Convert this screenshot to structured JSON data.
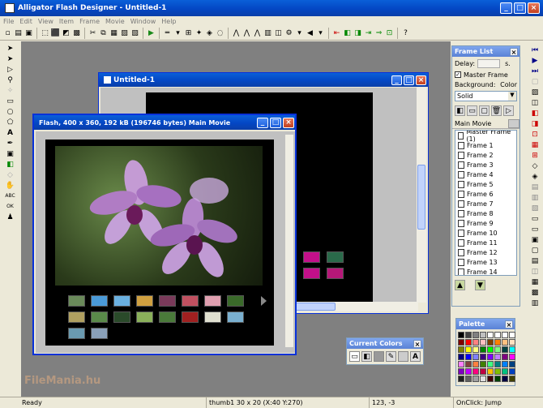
{
  "app": {
    "title": "Alligator Flash Designer - Untitled-1"
  },
  "menu": [
    "File",
    "Edit",
    "View",
    "Item",
    "Frame",
    "Movie",
    "Window",
    "Help"
  ],
  "doc_window": {
    "title": "Untitled-1"
  },
  "preview_window": {
    "title": "Flash, 400 x 360, 192 kB (196746 bytes) Main Movie"
  },
  "frame_list": {
    "title": "Frame List",
    "delay_label": "Delay:",
    "delay_unit": "s.",
    "master_frame_label": "Master Frame",
    "master_frame_checked": true,
    "background_label": "Background:",
    "color_label": "Color",
    "background_value": "Solid",
    "movie_label": "Main Movie",
    "items": [
      "Master Frame (1)",
      "Frame 1",
      "Frame 2",
      "Frame 3",
      "Frame 4",
      "Frame 5",
      "Frame 6",
      "Frame 7",
      "Frame 8",
      "Frame 9",
      "Frame 10",
      "Frame 11",
      "Frame 12",
      "Frame 13",
      "Frame 14"
    ]
  },
  "palette": {
    "title": "Palette",
    "colors": [
      "#000000",
      "#404040",
      "#808080",
      "#c0c0c0",
      "#ffffff",
      "#ffffff",
      "#ffffff",
      "#ffffff",
      "#800000",
      "#ff0000",
      "#ff8080",
      "#ffc0c0",
      "#804000",
      "#ff8000",
      "#ffc080",
      "#ffe0c0",
      "#808000",
      "#ffff00",
      "#ffff80",
      "#008000",
      "#00ff00",
      "#80ff80",
      "#004040",
      "#00ffff",
      "#000080",
      "#0000ff",
      "#8080ff",
      "#400080",
      "#8000ff",
      "#c080ff",
      "#800080",
      "#ff00ff",
      "#ff80ff",
      "#804040",
      "#ff8040",
      "#408000",
      "#40ff80",
      "#008080",
      "#0080ff",
      "#004080",
      "#8000c0",
      "#c000ff",
      "#ff0080",
      "#c00040",
      "#ffc000",
      "#80c000",
      "#00c080",
      "#0040c0",
      "#202020",
      "#606060",
      "#a0a0a0",
      "#e0e0e0",
      "#400000",
      "#004000",
      "#000040",
      "#404000"
    ]
  },
  "current_colors": {
    "title": "Current Colors"
  },
  "status": {
    "left": "Ready",
    "middle": "thumb1 30 x 20 (X:40 Y:270)",
    "coords": "123, -3",
    "action": "OnClick: Jump"
  },
  "watermark": "FileMania.hu"
}
